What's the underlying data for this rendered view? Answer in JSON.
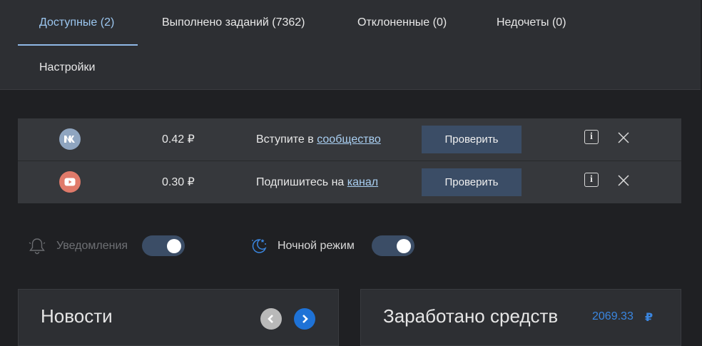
{
  "tabs": [
    {
      "label": "Доступные (2)",
      "active": true
    },
    {
      "label": "Выполнено заданий (7362)",
      "active": false
    },
    {
      "label": "Отклоненные (0)",
      "active": false
    },
    {
      "label": "Недочеты (0)",
      "active": false
    },
    {
      "label": "Настройки",
      "active": false
    }
  ],
  "tasks": [
    {
      "network": "vk-icon",
      "color": "#8fa5c0",
      "price": "0.42 ₽",
      "text": "Вступите в ",
      "link": "сообщество",
      "button": "Проверить"
    },
    {
      "network": "youtube-icon",
      "color": "#e07a6a",
      "price": "0.30 ₽",
      "text": "Подпишитесь на ",
      "link": "канал",
      "button": "Проверить"
    }
  ],
  "options": {
    "notifications_label": "Уведомления",
    "night_mode_label": "Ночной режим"
  },
  "news": {
    "title": "Новости"
  },
  "earnings": {
    "title": "Заработано средств",
    "amount": "2069.33",
    "currency": "₽"
  }
}
